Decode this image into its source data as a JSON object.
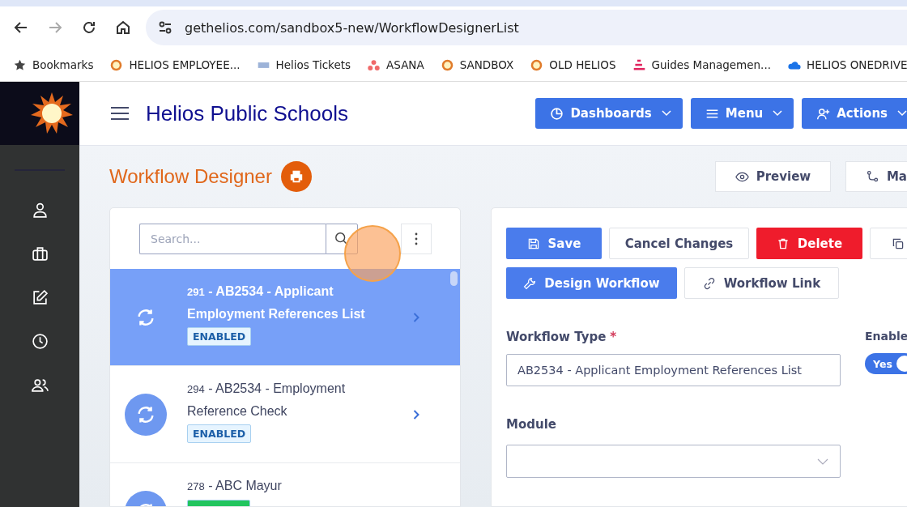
{
  "browser": {
    "url": "gethelios.com/sandbox5-new/WorkflowDesignerList",
    "bookmarks": [
      {
        "label": "Bookmarks",
        "kind": "star"
      },
      {
        "label": "HELIOS EMPLOYEE...",
        "kind": "sun"
      },
      {
        "label": "Helios Tickets",
        "kind": "wordmark"
      },
      {
        "label": "ASANA",
        "kind": "dots"
      },
      {
        "label": "SANDBOX",
        "kind": "sun"
      },
      {
        "label": "OLD HELIOS",
        "kind": "sun"
      },
      {
        "label": "Guides Managemen...",
        "kind": "bars"
      },
      {
        "label": "HELIOS ONEDRIVE",
        "kind": "cloud"
      }
    ]
  },
  "header": {
    "title": "Helios Public Schools",
    "buttons": [
      {
        "label": "Dashboards",
        "kind": "chart"
      },
      {
        "label": "Menu",
        "kind": "lines"
      },
      {
        "label": "Actions",
        "kind": "user-plus"
      }
    ]
  },
  "page": {
    "title": "Workflow Designer",
    "top_buttons": [
      {
        "label": "Preview",
        "kind": "eye"
      },
      {
        "label": "Ma",
        "kind": "branch"
      }
    ]
  },
  "list": {
    "search": {
      "placeholder": "Search..."
    },
    "items": [
      {
        "number": "291",
        "title": "- AB2534 - Applicant Employment References List",
        "status": "ENABLED",
        "color": "#e6f4ff",
        "selected": true
      },
      {
        "number": "294",
        "title": "- AB2534 - Employment Reference Check",
        "status": "ENABLED",
        "color": "#e6f4ff",
        "selected": false
      },
      {
        "number": "278",
        "title": "- ABC Mayur",
        "color": "#22c55e",
        "selected": false
      }
    ]
  },
  "form": {
    "action_rows": [
      [
        {
          "label": "Save",
          "kind": "save"
        },
        {
          "label": "Cancel Changes",
          "kind": "cancel"
        },
        {
          "label": "Delete",
          "kind": "delete"
        },
        {
          "kind": "copy"
        }
      ],
      [
        {
          "label": "Design Workflow",
          "kind": "design"
        },
        {
          "label": "Workflow Link",
          "kind": "link"
        }
      ]
    ],
    "workflow_type": {
      "label": "Workflow Type",
      "required_mark": "*",
      "value": "AB2534 - Applicant Employment References List"
    },
    "module": {
      "label": "Module"
    },
    "enable": {
      "label": "Enable",
      "on": true,
      "text": "Yes"
    }
  }
}
